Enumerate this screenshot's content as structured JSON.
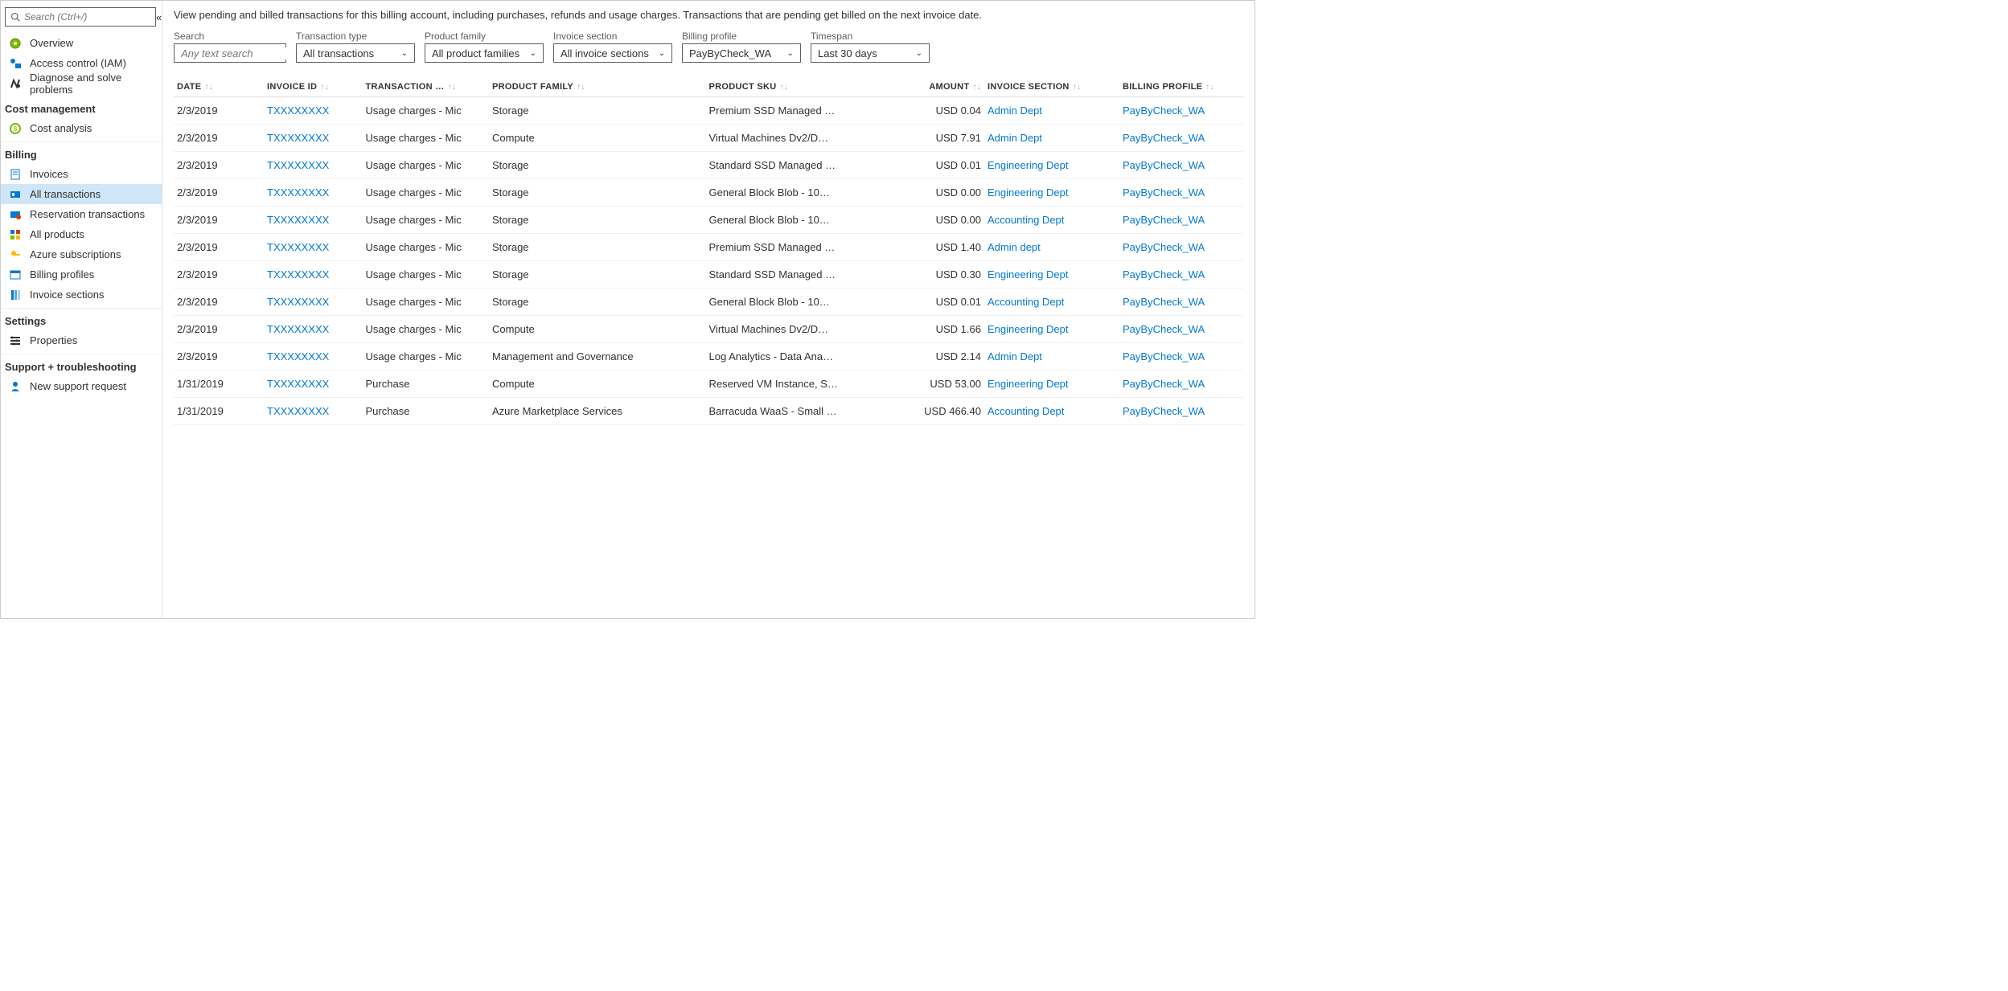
{
  "sidebar": {
    "search_placeholder": "Search (Ctrl+/)",
    "top": [
      {
        "icon": "overview",
        "label": "Overview"
      },
      {
        "icon": "iam",
        "label": "Access control (IAM)"
      },
      {
        "icon": "diag",
        "label": "Diagnose and solve problems"
      }
    ],
    "sections": [
      {
        "title": "Cost management",
        "items": [
          {
            "icon": "cost",
            "label": "Cost analysis"
          }
        ]
      },
      {
        "title": "Billing",
        "items": [
          {
            "icon": "inv",
            "label": "Invoices"
          },
          {
            "icon": "txn",
            "label": "All transactions",
            "active": true
          },
          {
            "icon": "res",
            "label": "Reservation transactions"
          },
          {
            "icon": "prod",
            "label": "All products"
          },
          {
            "icon": "key",
            "label": "Azure subscriptions"
          },
          {
            "icon": "bp",
            "label": "Billing profiles"
          },
          {
            "icon": "is",
            "label": "Invoice sections"
          }
        ]
      },
      {
        "title": "Settings",
        "items": [
          {
            "icon": "props",
            "label": "Properties"
          }
        ]
      },
      {
        "title": "Support + troubleshooting",
        "items": [
          {
            "icon": "support",
            "label": "New support request"
          }
        ]
      }
    ]
  },
  "description": "View pending and billed transactions for this billing account, including purchases, refunds and usage charges. Transactions that are pending get billed on the next invoice date.",
  "filters": {
    "search": {
      "label": "Search",
      "placeholder": "Any text search"
    },
    "transaction_type": {
      "label": "Transaction type",
      "value": "All transactions"
    },
    "product_family": {
      "label": "Product family",
      "value": "All product families"
    },
    "invoice_section": {
      "label": "Invoice section",
      "value": "All invoice sections"
    },
    "billing_profile": {
      "label": "Billing profile",
      "value": "PayByCheck_WA"
    },
    "timespan": {
      "label": "Timespan",
      "value": "Last 30 days"
    }
  },
  "columns": [
    "DATE",
    "INVOICE ID",
    "TRANSACTION …",
    "PRODUCT FAMILY",
    "PRODUCT SKU",
    "AMOUNT",
    "INVOICE SECTION",
    "BILLING PROFILE"
  ],
  "rows": [
    {
      "date": "2/3/2019",
      "invoice": "TXXXXXXXX",
      "txn": "Usage charges - Mic",
      "family": "Storage",
      "sku": "Premium SSD Managed …",
      "amount": "USD 0.04",
      "section": "Admin Dept",
      "profile": "PayByCheck_WA"
    },
    {
      "date": "2/3/2019",
      "invoice": "TXXXXXXXX",
      "txn": "Usage charges - Mic",
      "family": "Compute",
      "sku": "Virtual Machines Dv2/D…",
      "amount": "USD 7.91",
      "section": "Admin Dept",
      "profile": "PayByCheck_WA"
    },
    {
      "date": "2/3/2019",
      "invoice": "TXXXXXXXX",
      "txn": "Usage charges - Mic",
      "family": "Storage",
      "sku": "Standard SSD Managed …",
      "amount": "USD 0.01",
      "section": "Engineering Dept",
      "profile": "PayByCheck_WA"
    },
    {
      "date": "2/3/2019",
      "invoice": "TXXXXXXXX",
      "txn": "Usage charges - Mic",
      "family": "Storage",
      "sku": "General Block Blob - 10…",
      "amount": "USD 0.00",
      "section": "Engineering Dept",
      "profile": "PayByCheck_WA"
    },
    {
      "date": "2/3/2019",
      "invoice": "TXXXXXXXX",
      "txn": "Usage charges - Mic",
      "family": "Storage",
      "sku": "General Block Blob - 10…",
      "amount": "USD 0.00",
      "section": "Accounting Dept",
      "profile": "PayByCheck_WA"
    },
    {
      "date": "2/3/2019",
      "invoice": "TXXXXXXXX",
      "txn": "Usage charges - Mic",
      "family": "Storage",
      "sku": "Premium SSD Managed …",
      "amount": "USD 1.40",
      "section": "Admin dept",
      "profile": "PayByCheck_WA"
    },
    {
      "date": "2/3/2019",
      "invoice": "TXXXXXXXX",
      "txn": "Usage charges - Mic",
      "family": "Storage",
      "sku": "Standard SSD Managed …",
      "amount": "USD 0.30",
      "section": "Engineering Dept",
      "profile": "PayByCheck_WA"
    },
    {
      "date": "2/3/2019",
      "invoice": "TXXXXXXXX",
      "txn": "Usage charges - Mic",
      "family": "Storage",
      "sku": "General Block Blob - 10…",
      "amount": "USD 0.01",
      "section": "Accounting Dept",
      "profile": "PayByCheck_WA"
    },
    {
      "date": "2/3/2019",
      "invoice": "TXXXXXXXX",
      "txn": "Usage charges - Mic",
      "family": "Compute",
      "sku": "Virtual Machines Dv2/D…",
      "amount": "USD 1.66",
      "section": "Engineering Dept",
      "profile": "PayByCheck_WA"
    },
    {
      "date": "2/3/2019",
      "invoice": "TXXXXXXXX",
      "txn": "Usage charges - Mic",
      "family": "Management and Governance",
      "sku": "Log Analytics - Data Ana…",
      "amount": "USD 2.14",
      "section": "Admin Dept",
      "profile": "PayByCheck_WA"
    },
    {
      "date": "1/31/2019",
      "invoice": "TXXXXXXXX",
      "txn": "Purchase",
      "family": "Compute",
      "sku": "Reserved VM Instance, S…",
      "amount": "USD 53.00",
      "section": "Engineering Dept",
      "profile": "PayByCheck_WA"
    },
    {
      "date": "1/31/2019",
      "invoice": "TXXXXXXXX",
      "txn": "Purchase",
      "family": "Azure Marketplace Services",
      "sku": "Barracuda WaaS - Small …",
      "amount": "USD 466.40",
      "section": "Accounting Dept",
      "profile": "PayByCheck_WA"
    }
  ]
}
